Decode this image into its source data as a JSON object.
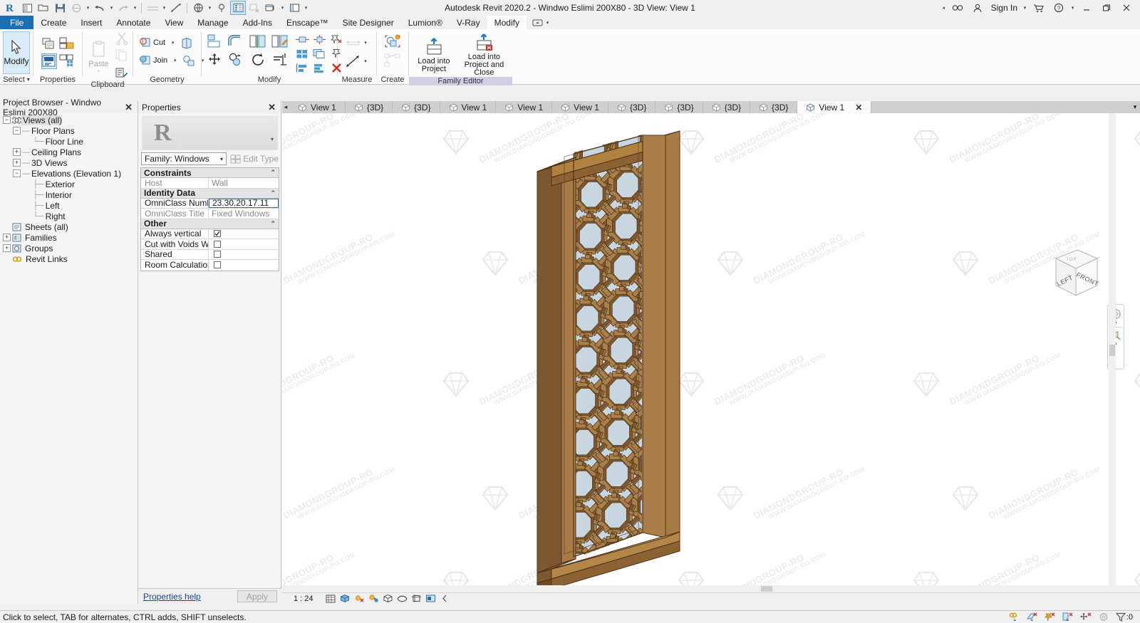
{
  "app": {
    "title": "Autodesk Revit 2020.2 - Windwo Eslimi 200X80 - 3D View: View 1",
    "sign_in": "Sign In"
  },
  "quick_access": {
    "icons": [
      "revit-logo-icon",
      "new-project-icon",
      "open-icon",
      "save-icon",
      "sync-icon",
      "undo-icon",
      "redo-icon",
      "measure-icon",
      "aligned-dimension-icon",
      "3d-view-icon",
      "section-icon",
      "thin-lines-icon",
      "close-hidden-windows-icon",
      "switch-windows-icon",
      "customize-qat-icon"
    ]
  },
  "ribbon": {
    "tabs": [
      {
        "label": "File",
        "state": "file"
      },
      {
        "label": "Create",
        "state": "normal"
      },
      {
        "label": "Insert",
        "state": "normal"
      },
      {
        "label": "Annotate",
        "state": "normal"
      },
      {
        "label": "View",
        "state": "normal"
      },
      {
        "label": "Manage",
        "state": "normal"
      },
      {
        "label": "Add-Ins",
        "state": "normal"
      },
      {
        "label": "Enscape™",
        "state": "normal"
      },
      {
        "label": "Site Designer",
        "state": "normal"
      },
      {
        "label": "Lumion®",
        "state": "normal"
      },
      {
        "label": "V-Ray",
        "state": "normal"
      },
      {
        "label": "Modify",
        "state": "active"
      }
    ],
    "panels": [
      {
        "title": "Select",
        "dropdown": true,
        "main_button": "Modify"
      },
      {
        "title": "Properties"
      },
      {
        "title": "Clipboard",
        "paste_label": "Paste"
      },
      {
        "title": "Geometry",
        "items": [
          "Cut",
          "Join"
        ]
      },
      {
        "title": "Modify"
      },
      {
        "title": "Measure"
      },
      {
        "title": "Create"
      },
      {
        "title": "Family Editor",
        "buttons": [
          "Load into Project",
          "Load into Project and Close"
        ]
      }
    ],
    "geometry_cut": "Cut",
    "geometry_join": "Join",
    "paste": "Paste",
    "modify_main": "Modify",
    "load_into_project": "Load into\nProject",
    "load_into_project_l1": "Load into",
    "load_into_project_l2": "Project",
    "load_close_l1": "Load into",
    "load_close_l2": "Project and Close",
    "family_editor": "Family Editor",
    "measure_title": "Measure",
    "create_title": "Create",
    "modify_title": "Modify",
    "select_title": "Select",
    "properties_title": "Properties",
    "clipboard_title": "Clipboard",
    "geometry_title": "Geometry"
  },
  "project_browser": {
    "title": "Project Browser - Windwo Eslimi 200X80",
    "nodes": [
      {
        "label": "Views (all)",
        "depth": 0,
        "expander": "-",
        "icon": "views-icon",
        "selected": true
      },
      {
        "label": "Floor Plans",
        "depth": 1,
        "expander": "-",
        "icon": "none"
      },
      {
        "label": "Floor Line",
        "depth": 2,
        "expander": "none",
        "icon": "none"
      },
      {
        "label": "Ceiling Plans",
        "depth": 1,
        "expander": "+",
        "icon": "none"
      },
      {
        "label": "3D Views",
        "depth": 1,
        "expander": "+",
        "icon": "none"
      },
      {
        "label": "Elevations (Elevation 1)",
        "depth": 1,
        "expander": "-",
        "icon": "none"
      },
      {
        "label": "Exterior",
        "depth": 2,
        "expander": "none",
        "icon": "none"
      },
      {
        "label": "Interior",
        "depth": 2,
        "expander": "none",
        "icon": "none"
      },
      {
        "label": "Left",
        "depth": 2,
        "expander": "none",
        "icon": "none"
      },
      {
        "label": "Right",
        "depth": 2,
        "expander": "none",
        "icon": "none"
      },
      {
        "label": "Sheets (all)",
        "depth": 0,
        "expander": "none",
        "icon": "sheets-icon"
      },
      {
        "label": "Families",
        "depth": 0,
        "expander": "+",
        "icon": "families-icon"
      },
      {
        "label": "Groups",
        "depth": 0,
        "expander": "+",
        "icon": "groups-icon"
      },
      {
        "label": "Revit Links",
        "depth": 0,
        "expander": "none",
        "icon": "links-icon"
      }
    ]
  },
  "properties": {
    "title": "Properties",
    "type_selector": "Family: Windows",
    "edit_type": "Edit Type",
    "groups": [
      {
        "name": "Constraints",
        "rows": [
          {
            "name": "Host",
            "value": "Wall",
            "kind": "text",
            "dimmed": true
          }
        ]
      },
      {
        "name": "Identity Data",
        "rows": [
          {
            "name": "OmniClass Number",
            "value": "23.30.20.17.11",
            "kind": "text",
            "focused": true
          },
          {
            "name": "OmniClass Title",
            "value": "Fixed Windows",
            "kind": "text",
            "dimmed": true
          }
        ]
      },
      {
        "name": "Other",
        "rows": [
          {
            "name": "Always vertical",
            "value": "",
            "kind": "checkbox",
            "checked": true
          },
          {
            "name": "Cut with Voids Wh...",
            "value": "",
            "kind": "checkbox",
            "checked": false
          },
          {
            "name": "Shared",
            "value": "",
            "kind": "checkbox",
            "checked": false
          },
          {
            "name": "Room Calculation ...",
            "value": "",
            "kind": "checkbox",
            "checked": false
          }
        ]
      }
    ],
    "help_link": "Properties help",
    "apply_label": "Apply"
  },
  "view_tabs": [
    {
      "label": "View 1",
      "active": false
    },
    {
      "label": "{3D}",
      "active": false
    },
    {
      "label": "{3D}",
      "active": false
    },
    {
      "label": "View 1",
      "active": false
    },
    {
      "label": "View 1",
      "active": false
    },
    {
      "label": "View 1",
      "active": false
    },
    {
      "label": "{3D}",
      "active": false
    },
    {
      "label": "{3D}",
      "active": false
    },
    {
      "label": "{3D}",
      "active": false
    },
    {
      "label": "{3D}",
      "active": false
    },
    {
      "label": "View 1",
      "active": true
    }
  ],
  "view_control_bar": {
    "scale": "1 : 24",
    "icons": [
      "detail-level-icon",
      "visual-style-icon",
      "sun-path-icon",
      "shadows-icon",
      "rendering-dialog-icon",
      "crop-view-icon",
      "show-crop-region-icon",
      "temporary-hide-isolate-icon",
      "reveal-hidden-elements-icon",
      "expand-arrow-icon"
    ]
  },
  "viewcube": {
    "face_left": "LEFT",
    "face_front": "FRONT",
    "face_top": "TOP"
  },
  "navigation_bar": {
    "icons": [
      "steering-wheel-icon",
      "zoom-icon"
    ]
  },
  "status_bar": {
    "message": "Click to select, TAB for alternates, CTRL adds, SHIFT unselects.",
    "right_icons": [
      "select-links-icon",
      "select-underlay-elements-icon",
      "select-pinned-elements-icon",
      "select-elements-by-face-icon",
      "drag-elements-on-selection-icon",
      "worksets-icon"
    ],
    "filter_label": ":0"
  },
  "model": {
    "name": "Windwo Eslimi 200X80",
    "frame_color": "#9c6f3f",
    "frame_dark": "#6f4e2b",
    "frame_light": "#b98b52",
    "glass_color": "#c3d3dd"
  },
  "watermark": {
    "line1": "DIAMONDGROUP-RO",
    "line2": "WWW.DIAMONDGROUP-RO.COM"
  }
}
